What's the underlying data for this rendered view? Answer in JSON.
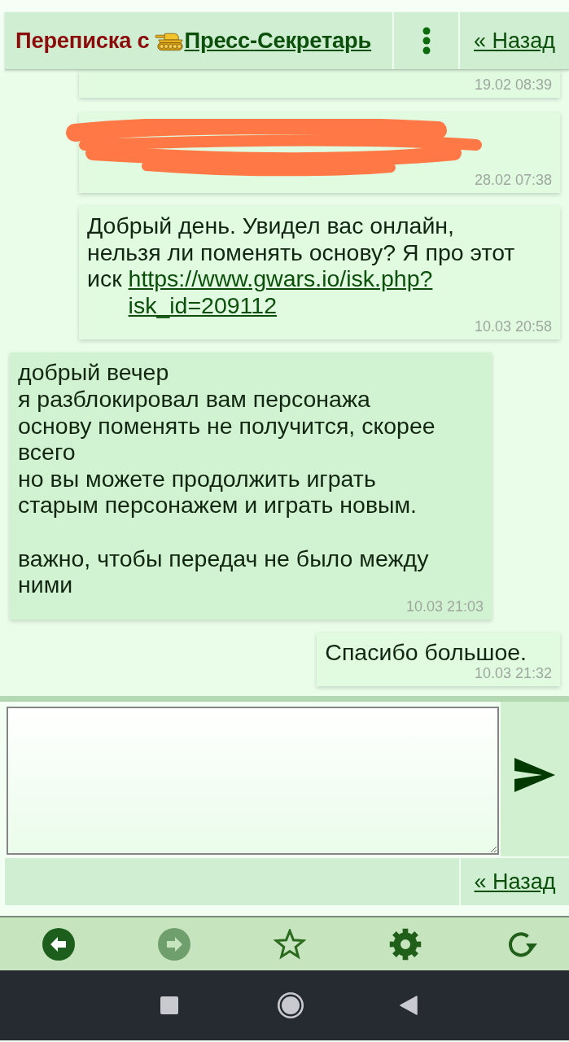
{
  "header": {
    "title": "Переписка с",
    "contact": "Пресс-Секретарь",
    "back_link": "« Назад"
  },
  "messages": [
    {
      "kind": "outgoing",
      "redacted": false,
      "time": "19.02 08:39"
    },
    {
      "kind": "outgoing",
      "redacted": true,
      "time": "28.02 07:38"
    },
    {
      "kind": "outgoing",
      "redacted": false,
      "text": "Добрый день. Увидел вас онлайн, нельзя ли поменять основу? Я про этот иск",
      "link": "https://www.gwars.io/isk.php?isk_id=209112",
      "time": "10.03 20:58"
    },
    {
      "kind": "incoming",
      "redacted": false,
      "text": "добрый вечер\nя разблокировал вам персонажа\nоснову поменять не получится, скорее всего\nно вы можете продолжить играть старым персонажем и играть новым.\n\nважно, чтобы передач не было между ними",
      "time": "10.03 21:03"
    },
    {
      "kind": "outgoing",
      "redacted": false,
      "text": "Спасибо большое.",
      "time": "10.03 21:32"
    }
  ],
  "footer": {
    "back_link": "« Назад"
  },
  "browser_toolbar": {
    "back": {
      "disabled": false
    },
    "forward": {
      "disabled": true
    }
  }
}
